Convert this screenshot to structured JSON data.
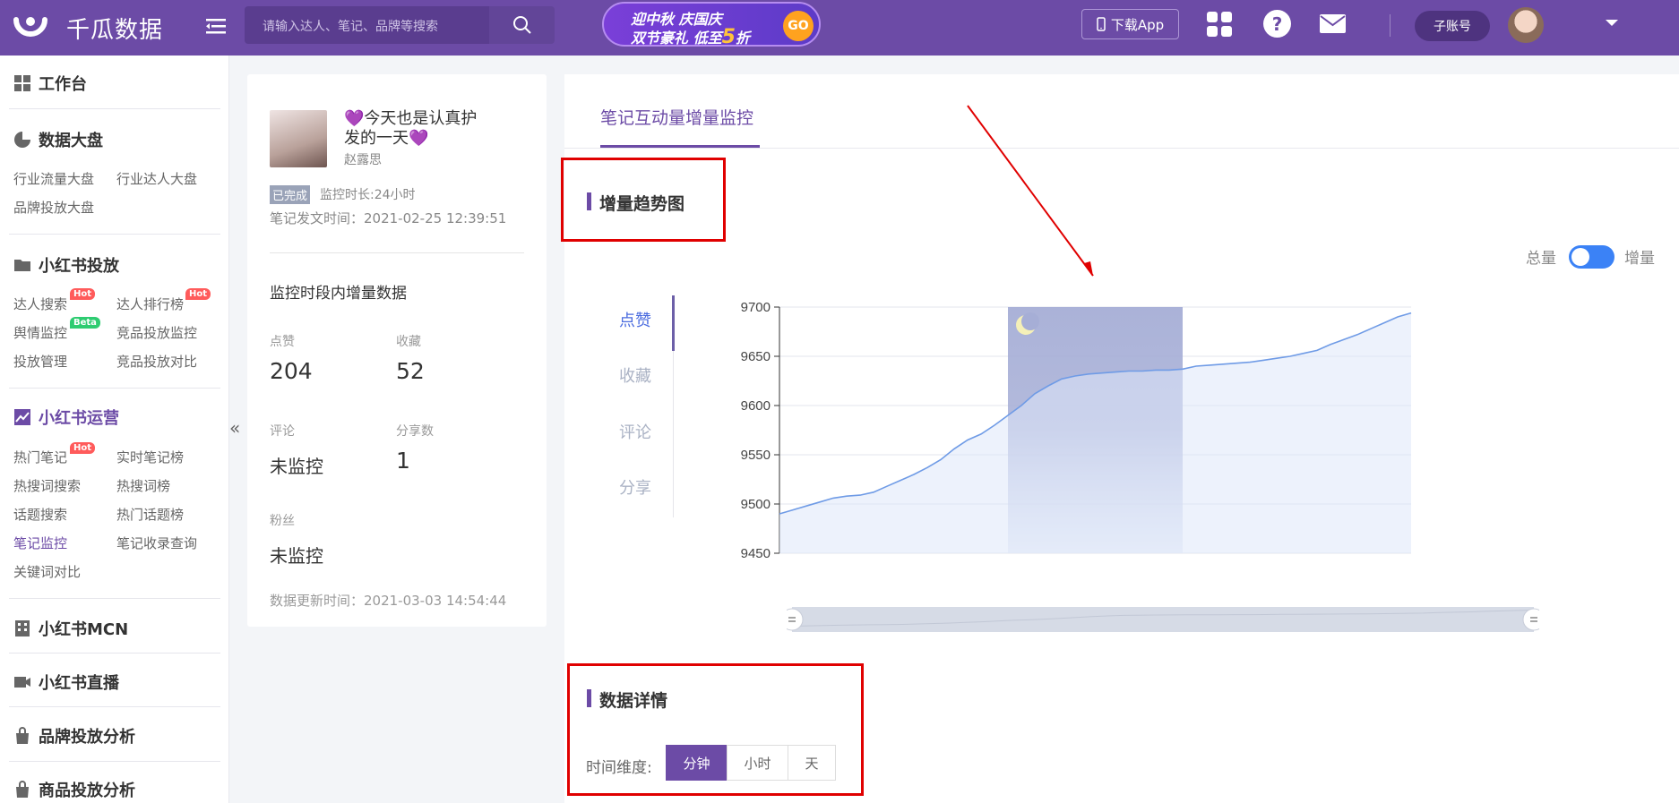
{
  "app": {
    "name": "千瓜数据"
  },
  "search": {
    "placeholder": "请输入达人、笔记、品牌等搜索"
  },
  "promo": {
    "line1": "迎中秋 庆国庆",
    "line2_prefix": "双节豪礼 低至",
    "line2_num": "5",
    "line2_suffix": "折",
    "go": "GO"
  },
  "header": {
    "download_app": "下载App",
    "subaccount": "子账号"
  },
  "sidebar": {
    "workbench": "工作台",
    "data_board": {
      "title": "数据大盘",
      "links": [
        "行业流量大盘",
        "行业达人大盘",
        "品牌投放大盘"
      ]
    },
    "xhs_ads": {
      "title": "小红书投放",
      "links": [
        "达人搜索",
        "达人排行榜",
        "舆情监控",
        "竞品投放监控",
        "投放管理",
        "竞品投放对比"
      ]
    },
    "xhs_ops": {
      "title": "小红书运营",
      "links": [
        "热门笔记",
        "实时笔记榜",
        "热搜词搜索",
        "热搜词榜",
        "话题搜索",
        "热门话题榜",
        "笔记监控",
        "笔记收录查询",
        "关键词对比"
      ]
    },
    "mcn": "小红书MCN",
    "live": "小红书直播",
    "brand": "品牌投放分析",
    "product": "商品投放分析",
    "badges": {
      "hot": "Hot",
      "beta": "Beta"
    }
  },
  "note": {
    "title_prefix": "💜",
    "title": "今天也是认真护发的一天",
    "title_suffix": "💜",
    "author": "赵露思",
    "status": "已完成",
    "monitor_duration": "监控时长:24小时",
    "publish_time": "笔记发文时间：2021-02-25 12:39:51",
    "period_title": "监控时段内增量数据",
    "stats": [
      {
        "label": "点赞",
        "value": "204"
      },
      {
        "label": "收藏",
        "value": "52"
      },
      {
        "label": "评论",
        "value": "未监控"
      },
      {
        "label": "分享数",
        "value": "1"
      },
      {
        "label": "粉丝",
        "value": "未监控"
      }
    ],
    "update_time": "数据更新时间：2021-03-03 14:54:44"
  },
  "main": {
    "tab": "笔记互动量增量监控",
    "trend_title": "增量趋势图",
    "toggle_left": "总量",
    "toggle_right": "增量",
    "metric_tabs": [
      "点赞",
      "收藏",
      "评论",
      "分享"
    ],
    "detail_title": "数据详情",
    "time_dim_label": "时间维度:",
    "time_dims": [
      "分钟",
      "小时",
      "天"
    ]
  },
  "colors": {
    "brand": "#6c4ba6",
    "line": "#6f9be6",
    "night": "#a6aed6",
    "annotation": "#e00000"
  },
  "chart_data": {
    "type": "area",
    "ylim": [
      9450,
      9700
    ],
    "yticks": [
      9700,
      9650,
      9600,
      9550,
      9500,
      9450
    ],
    "series": [
      {
        "values": [
          9490,
          9494,
          9498,
          9502,
          9506,
          9508,
          9509,
          9512,
          9518,
          9524,
          9530,
          9537,
          9545,
          9556,
          9565,
          9571,
          9580,
          9590,
          9600,
          9612,
          9620,
          9627,
          9630,
          9632,
          9633,
          9634,
          9635,
          9635,
          9636,
          9636,
          9637,
          9640,
          9641,
          9642,
          9643,
          9644,
          9646,
          9648,
          9650,
          9653,
          9656,
          9662,
          9667,
          9672,
          9678,
          9684,
          9690,
          9694
        ]
      }
    ],
    "night_band": {
      "start_index": 17,
      "end_index": 30
    }
  }
}
